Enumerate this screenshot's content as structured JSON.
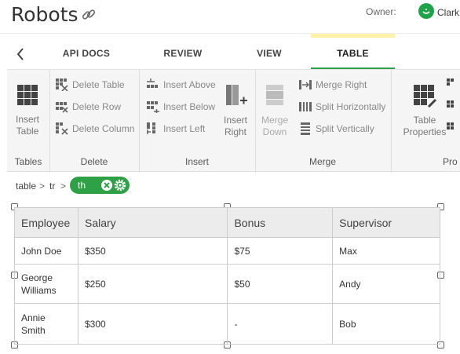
{
  "header": {
    "title": "Robots",
    "owner_label": "Owner:",
    "owner_name": "Clark"
  },
  "tabs": [
    {
      "label": "API DOCS"
    },
    {
      "label": "REVIEW"
    },
    {
      "label": "VIEW"
    },
    {
      "label": "TABLE",
      "active": true
    }
  ],
  "ribbon": {
    "groups": {
      "tables": "Tables",
      "delete": "Delete",
      "insert": "Insert",
      "merge": "Merge",
      "properties": "Pro"
    },
    "insert_table": "Insert Table",
    "delete_table": "Delete Table",
    "delete_row": "Delete Row",
    "delete_column": "Delete Column",
    "insert_above": "Insert Above",
    "insert_below": "Insert Below",
    "insert_left": "Insert Left",
    "insert_right": "Insert Right",
    "merge_down": "Merge Down",
    "merge_right": "Merge Right",
    "split_horizontally": "Split Horizontally",
    "split_vertically": "Split Vertically",
    "table_properties": "Table Properties"
  },
  "breadcrumb": {
    "items": [
      "table",
      "tr"
    ],
    "separator": ">",
    "active": "th"
  },
  "table": {
    "headers": [
      "Employee",
      "Salary",
      "Bonus",
      "Supervisor"
    ],
    "rows": [
      [
        "John Doe",
        "$350",
        "$75",
        "Max"
      ],
      [
        "George Williams",
        "$250",
        "$50",
        "Andy"
      ],
      [
        "Annie Smith",
        "$300",
        "-",
        "Bob"
      ]
    ]
  },
  "colors": {
    "accent": "#2fa14a",
    "tab_highlight": "#fdf1a8",
    "avatar": "#1fa34a"
  }
}
